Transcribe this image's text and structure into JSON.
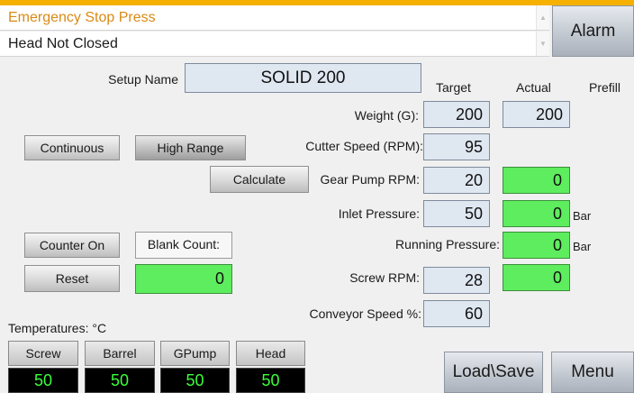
{
  "messages": [
    {
      "text": "Emergency Stop  Press",
      "level": "warning"
    },
    {
      "text": "Head Not Closed",
      "level": "normal"
    }
  ],
  "alarm_button": "Alarm",
  "setup": {
    "label": "Setup Name",
    "value": "SOLID 200"
  },
  "column_headers": {
    "target": "Target",
    "actual": "Actual",
    "prefill": "Prefill"
  },
  "params": {
    "weight": {
      "label": "Weight (G):",
      "target": "200",
      "actual": "200"
    },
    "cutter_speed": {
      "label": "Cutter Speed (RPM):",
      "target": "95"
    },
    "gear_pump": {
      "label": "Gear Pump RPM:",
      "target": "20",
      "actual": "0"
    },
    "inlet_pressure": {
      "label": "Inlet Pressure:",
      "target": "50",
      "actual": "0",
      "unit": "Bar"
    },
    "running_pressure": {
      "label": "Running Pressure:",
      "actual": "0",
      "unit": "Bar"
    },
    "screw_rpm": {
      "label": "Screw RPM:",
      "target": "28",
      "actual": "0"
    },
    "conveyor_speed": {
      "label": "Conveyor Speed %:",
      "target": "60"
    }
  },
  "buttons": {
    "continuous": "Continuous",
    "high_range": "High Range",
    "calculate": "Calculate",
    "counter_on": "Counter On",
    "reset": "Reset",
    "load_save": "Load\\Save",
    "menu": "Menu"
  },
  "blank_count": {
    "label": "Blank Count:",
    "value": "0"
  },
  "temperatures": {
    "title": "Temperatures: °C",
    "zones": [
      {
        "name": "Screw",
        "value": "50"
      },
      {
        "name": "Barrel",
        "value": "50"
      },
      {
        "name": "GPump",
        "value": "50"
      },
      {
        "name": "Head",
        "value": "50"
      }
    ]
  },
  "colors": {
    "warning_text": "#d98a15",
    "active_green": "#5eed5e",
    "input_blue": "#dfe7f1",
    "temp_display": "#000000"
  }
}
